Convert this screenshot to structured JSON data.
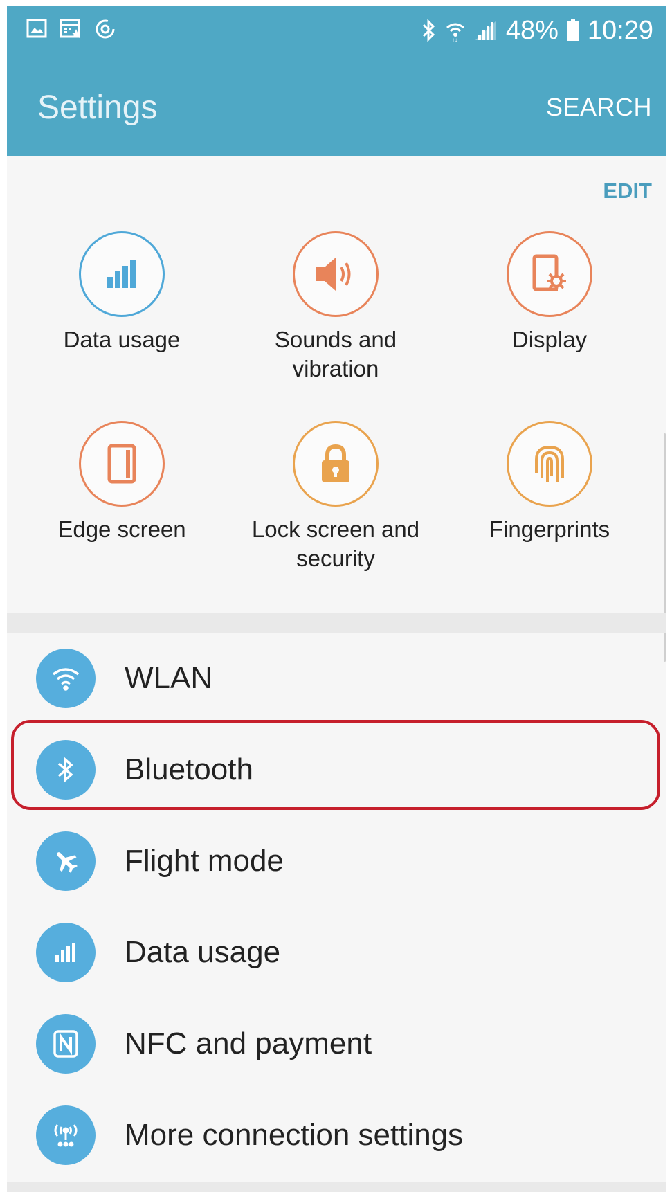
{
  "status_bar": {
    "battery": "48%",
    "time": "10:29",
    "left_icons": [
      "gallery-icon",
      "calendar-star-icon",
      "sync-icon"
    ],
    "right_icons": [
      "bluetooth-icon",
      "wifi-icon",
      "signal-icon",
      "battery-icon"
    ]
  },
  "app_bar": {
    "title": "Settings",
    "search_label": "SEARCH",
    "color": "#4fa8c5"
  },
  "quick_settings": {
    "edit_label": "EDIT",
    "items": [
      {
        "label": "Data usage",
        "icon": "data-usage-icon",
        "color": "#4fa8d8"
      },
      {
        "label": "Sounds and vibration",
        "icon": "speaker-icon",
        "color": "#e8845a"
      },
      {
        "label": "Display",
        "icon": "display-icon",
        "color": "#e8845a"
      },
      {
        "label": "Edge screen",
        "icon": "edge-screen-icon",
        "color": "#e8845a"
      },
      {
        "label": "Lock screen and security",
        "icon": "lock-icon",
        "color": "#e9a34e"
      },
      {
        "label": "Fingerprints",
        "icon": "fingerprint-icon",
        "color": "#e9a34e"
      }
    ]
  },
  "connections": {
    "items": [
      {
        "label": "WLAN",
        "icon": "wifi-icon"
      },
      {
        "label": "Bluetooth",
        "icon": "bluetooth-icon",
        "highlighted": true
      },
      {
        "label": "Flight mode",
        "icon": "airplane-icon"
      },
      {
        "label": "Data usage",
        "icon": "data-usage-icon"
      },
      {
        "label": "NFC and payment",
        "icon": "nfc-icon"
      },
      {
        "label": "More connection settings",
        "icon": "antenna-icon"
      }
    ],
    "icon_color": "#56aedd",
    "highlight_color": "#c61f2c"
  }
}
